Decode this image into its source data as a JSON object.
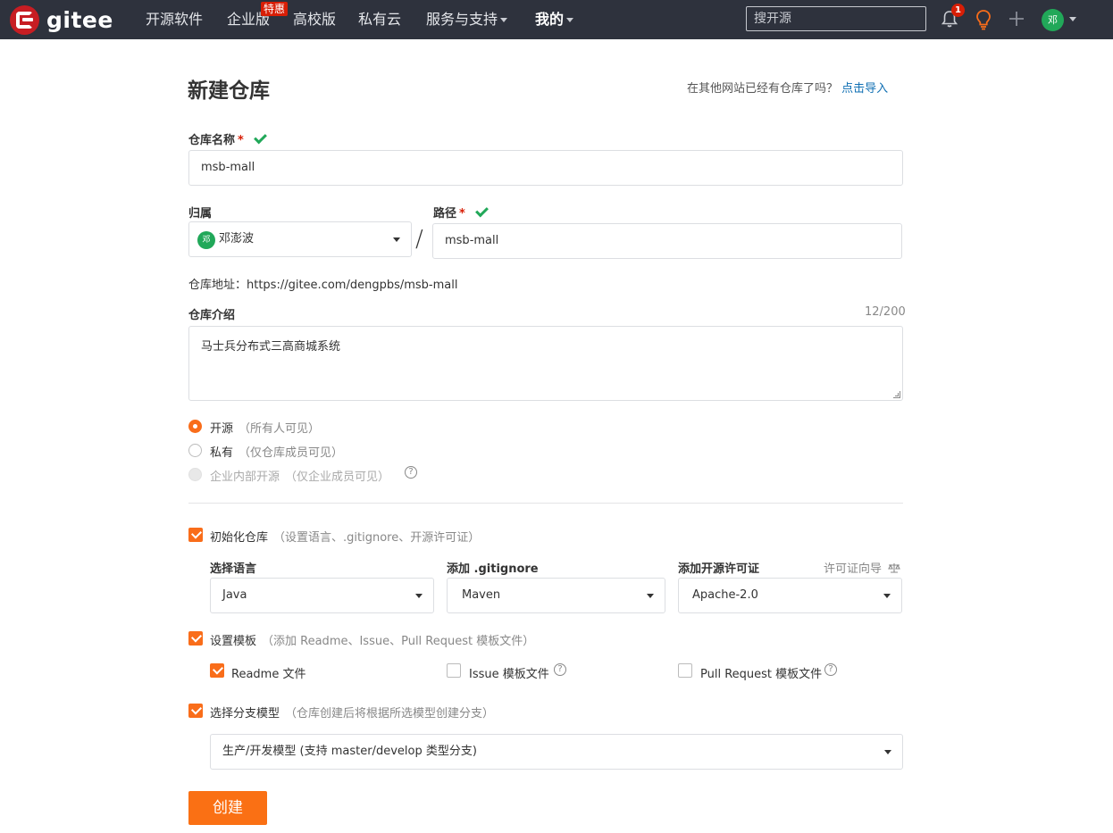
{
  "nav": {
    "brand": "gitee",
    "items": [
      {
        "label": "开源软件"
      },
      {
        "label": "企业版"
      },
      {
        "label": "高校版"
      },
      {
        "label": "私有云"
      },
      {
        "label": "服务与支持"
      },
      {
        "label": "我的"
      }
    ],
    "hot_badge": "特惠",
    "search_placeholder": "搜开源",
    "notification_count": "1",
    "user_avatar": "邓"
  },
  "form": {
    "title": "新建仓库",
    "import_hint": "在其他网站已经有仓库了吗？",
    "import_link": "点击导入",
    "repo_name_label": "仓库名称",
    "repo_name_value": "msb-mall",
    "owner_label": "归属",
    "owner_avatar": "邓",
    "owner_value": "邓澎波",
    "path_label": "路径",
    "path_value": "msb-mall",
    "required_mark": "*",
    "slash": "/",
    "repo_url": "仓库地址：https://gitee.com/dengpbs/msb-mall",
    "desc_label": "仓库介绍",
    "desc_counter": "12/200",
    "desc_value": "马士兵分布式三高商城系统",
    "visibility": [
      {
        "label": "开源",
        "note": "（所有人可见）",
        "state": "selected"
      },
      {
        "label": "私有",
        "note": "（仅仓库成员可见）",
        "state": "unselected"
      },
      {
        "label": "企业内部开源",
        "note": "（仅企业成员可见）",
        "state": "disabled"
      }
    ],
    "init_repo_label": "初始化仓库",
    "init_repo_note": "（设置语言、.gitignore、开源许可证）",
    "language_label": "选择语言",
    "language_value": "Java",
    "gitignore_label": "添加 .gitignore",
    "gitignore_value": "Maven",
    "license_label": "添加开源许可证",
    "license_value": "Apache-2.0",
    "license_guide": "许可证向导",
    "template_label": "设置模板",
    "template_note": "（添加 Readme、Issue、Pull Request 模板文件）",
    "template_readme": "Readme 文件",
    "template_issue": "Issue 模板文件",
    "template_pr": "Pull Request 模板文件",
    "branch_label": "选择分支模型",
    "branch_note": "（仓库创建后将根据所选模型创建分支）",
    "branch_value": "生产/开发模型 (支持 master/develop 类型分支)",
    "create_button": "创建"
  },
  "colors": {
    "nav_bg": "#2e323d",
    "accent": "#f96d1a",
    "success": "#21a859",
    "link": "#0f6fb3",
    "required": "#d81e06"
  }
}
